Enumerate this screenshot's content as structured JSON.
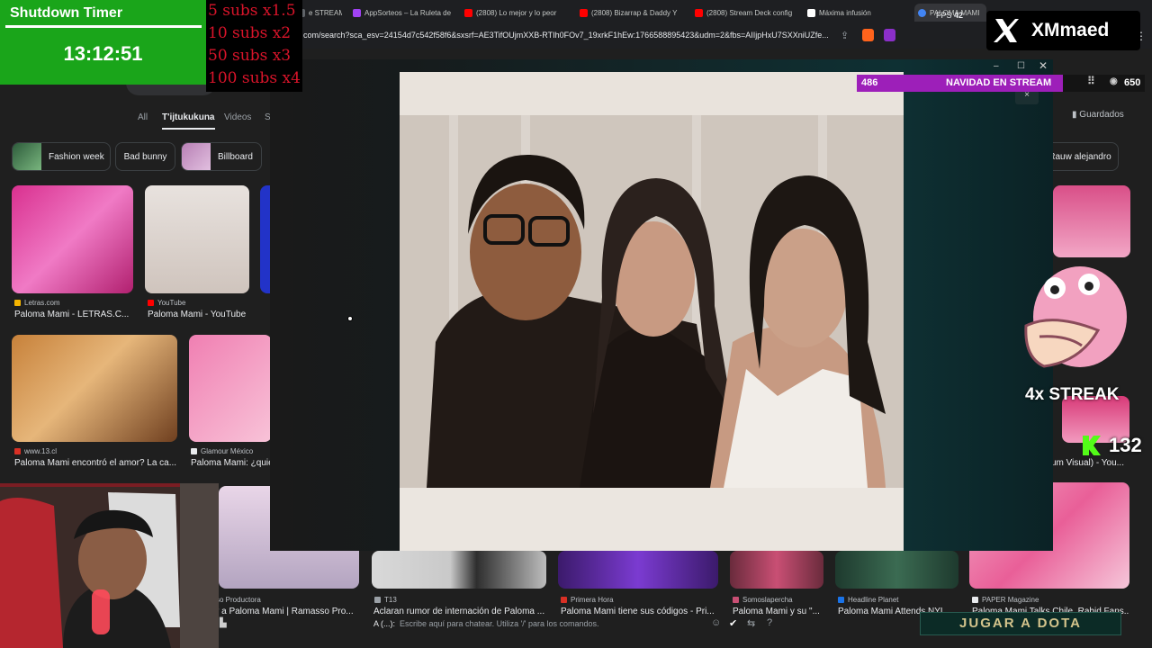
{
  "browser": {
    "tabs": [
      {
        "label": "e STREAM",
        "color": "#5f6368"
      },
      {
        "label": "AppSorteos – La Ruleta de",
        "color": "#a142f4"
      },
      {
        "label": "(2808) Lo mejor y lo peor",
        "color": "#ff0000"
      },
      {
        "label": "(2808) Bizarrap & Daddy Y",
        "color": "#ff0000"
      },
      {
        "label": "(2808) Stream Deck config",
        "color": "#ff0000"
      },
      {
        "label": "Máxima infusión",
        "color": "#ffffff"
      },
      {
        "label": "PALOMA MAMI",
        "color": "#4285f4"
      }
    ],
    "fps_label": "FPS",
    "fps_value": "42",
    "url": "com/search?sca_esv=24154d7c542f58f6&sxsrf=AE3TifOUjmXXB-RTIh0FOv7_19xrkF1hEw:1766588895423&udm=2&fbs=AIIjpHxU7SXXniUZfe..."
  },
  "google": {
    "tabs": [
      "All",
      "T'ijtukukuna",
      "Videos",
      "S"
    ],
    "active_tab": "T'ijtukukuna",
    "saved": "Guardados",
    "chips": [
      "Fashion week",
      "Bad bunny",
      "Billboard",
      "Rauw alejandro"
    ],
    "results": [
      {
        "source": "Letras.com",
        "caption": "Paloma Mami - LETRAS.C..."
      },
      {
        "source": "YouTube",
        "caption": "Paloma Mami - YouTube"
      },
      {
        "source": "www.13.cl",
        "caption": "Paloma Mami encontró el amor? La ca..."
      },
      {
        "source": "Glamour México",
        "caption": "Paloma Mami: ¿quié"
      },
      {
        "source": "so Productora",
        "caption": "r a Paloma Mami | Ramasso Pro..."
      },
      {
        "source": "T13",
        "caption": "Aclaran rumor de internación de Paloma ..."
      },
      {
        "source": "Primera Hora",
        "caption": "Paloma Mami tiene sus códigos - Pri..."
      },
      {
        "source": "Somoslapercha",
        "caption": "Paloma Mami y su \"..."
      },
      {
        "source": "Headline Planet",
        "caption": "Paloma Mami Attends NYL..."
      },
      {
        "source": "PAPER Magazine",
        "caption": "Paloma Mami Talks Chile, Rabid Fans..."
      },
      {
        "source": "",
        "caption": "um Visual) - You..."
      }
    ]
  },
  "overlay": {
    "timer_title": "Shutdown Timer",
    "timer_value": "13:12:51",
    "subs_rules": [
      "5 subs x1.5",
      "10 subs x2",
      "50 subs x3",
      "100 subs x4"
    ],
    "nav_count": "486",
    "nav_label": "NAVIDAD EN STREAM",
    "viewer_count": "650",
    "brand_name": "XMmaed",
    "streak": "4x STREAK",
    "kick_count": "132",
    "chat_user": "A (...):",
    "chat_placeholder": "Escribe aquí para chatear. Utiliza '/' para los comandos.",
    "game_banner": "JUGAR A DOTA"
  },
  "colors": {
    "timer_bg": "#1aa51a",
    "subs_text": "#d9142a",
    "nav_bg": "#9d1fb9",
    "kick_green": "#53fc18"
  }
}
